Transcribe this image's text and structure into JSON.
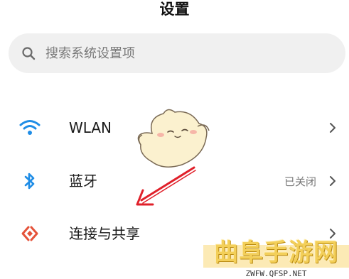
{
  "header": {
    "title": "设置"
  },
  "search": {
    "placeholder": "搜索系统设置项"
  },
  "settings": {
    "items": [
      {
        "label": "WLAN",
        "status": "",
        "icon": "wifi-icon"
      },
      {
        "label": "蓝牙",
        "status": "已关闭",
        "icon": "bluetooth-icon"
      },
      {
        "label": "连接与共享",
        "status": "",
        "icon": "connection-share-icon"
      }
    ]
  },
  "overlay": {
    "mascot": "cartoon-mascot",
    "arrow": "red-arrow-icon"
  },
  "watermark": {
    "title": "曲阜手游网",
    "url": "ZWFW.QFSP.NET"
  },
  "colors": {
    "accent_blue": "#1f8de6",
    "connection_red": "#e5533a",
    "arrow_red": "#e0202a",
    "search_bg": "#f0f0f0",
    "watermark_yellow": "#f3cf59"
  }
}
